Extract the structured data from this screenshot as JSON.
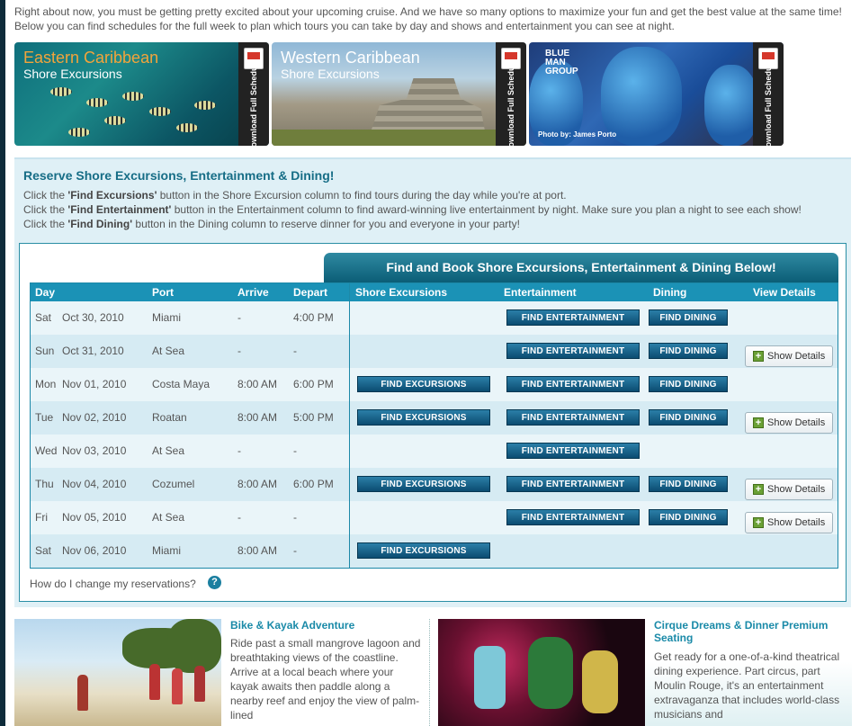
{
  "intro": "Right about now, you must be getting pretty excited about your upcoming cruise. And we have so many options to maximize your fun and get the best value at the same time! Below you can find schedules for the full week to plan which tours you can take by day and shows and entertainment you can see at night.",
  "banners": [
    {
      "title": "Eastern Caribbean",
      "subtitle": "Shore Excursions",
      "download": "Download Full Schedule"
    },
    {
      "title": "Western Caribbean",
      "subtitle": "Shore Excursions",
      "download": "Download Full Schedule"
    },
    {
      "logo": "BLUE MAN GROUP",
      "credit": "Photo by: James Porto",
      "download": "Download Full Schedule"
    }
  ],
  "reserve": {
    "title": "Reserve Shore Excursions, Entertainment & Dining!",
    "lines": [
      {
        "pre": "Click the ",
        "bold": "'Find Excursions'",
        "post": " button in the Shore Excursion column to find tours during the day while you're at port."
      },
      {
        "pre": "Click the ",
        "bold": "'Find Entertainment'",
        "post": " button in the Entertainment column to find award-winning live entertainment by night. Make sure you plan a night to see each show!"
      },
      {
        "pre": "Click the ",
        "bold": "'Find Dining'",
        "post": " button in the Dining column to reserve dinner for you and everyone in your party!"
      }
    ],
    "table_banner": "Find and Book Shore Excursions, Entertainment & Dining Below!",
    "headers": {
      "day": "Day",
      "port": "Port",
      "arrive": "Arrive",
      "depart": "Depart",
      "excursions": "Shore Excursions",
      "entertainment": "Entertainment",
      "dining": "Dining",
      "details": "View Details"
    },
    "buttons": {
      "excursions": "FIND EXCURSIONS",
      "entertainment": "FIND ENTERTAINMENT",
      "dining": "FIND DINING",
      "details": "Show Details"
    },
    "rows": [
      {
        "dow": "Sat",
        "date": "Oct 30, 2010",
        "port": "Miami",
        "arrive": "-",
        "depart": "4:00 PM"
      },
      {
        "dow": "Sun",
        "date": "Oct 31, 2010",
        "port": "At Sea",
        "arrive": "-",
        "depart": "-"
      },
      {
        "dow": "Mon",
        "date": "Nov 01, 2010",
        "port": "Costa Maya",
        "arrive": "8:00 AM",
        "depart": "6:00 PM"
      },
      {
        "dow": "Tue",
        "date": "Nov 02, 2010",
        "port": "Roatan",
        "arrive": "8:00 AM",
        "depart": "5:00 PM"
      },
      {
        "dow": "Wed",
        "date": "Nov 03, 2010",
        "port": "At Sea",
        "arrive": "-",
        "depart": "-"
      },
      {
        "dow": "Thu",
        "date": "Nov 04, 2010",
        "port": "Cozumel",
        "arrive": "8:00 AM",
        "depart": "6:00 PM"
      },
      {
        "dow": "Fri",
        "date": "Nov 05, 2010",
        "port": "At Sea",
        "arrive": "-",
        "depart": "-"
      },
      {
        "dow": "Sat",
        "date": "Nov 06, 2010",
        "port": "Miami",
        "arrive": "8:00 AM",
        "depart": "-"
      }
    ],
    "help": "How do I change my reservations?",
    "help_icon": "?"
  },
  "promos": [
    {
      "title": "Bike & Kayak Adventure",
      "text": "Ride past a small mangrove lagoon and breathtaking views of the coastline. Arrive at a local beach where your kayak awaits then paddle along a nearby reef and enjoy the view of palm-lined"
    },
    {
      "title": "Cirque Dreams & Dinner Premium Seating",
      "text": "Get ready for a one-of-a-kind theatrical dining experience. Part circus, part Moulin Rouge, it's an entertainment extravaganza that includes world-class musicians and"
    }
  ],
  "colors": {
    "accent": "#1b92b6",
    "button": "#0b4c71",
    "title_orange": "#f2a43b",
    "heading": "#166d86"
  }
}
